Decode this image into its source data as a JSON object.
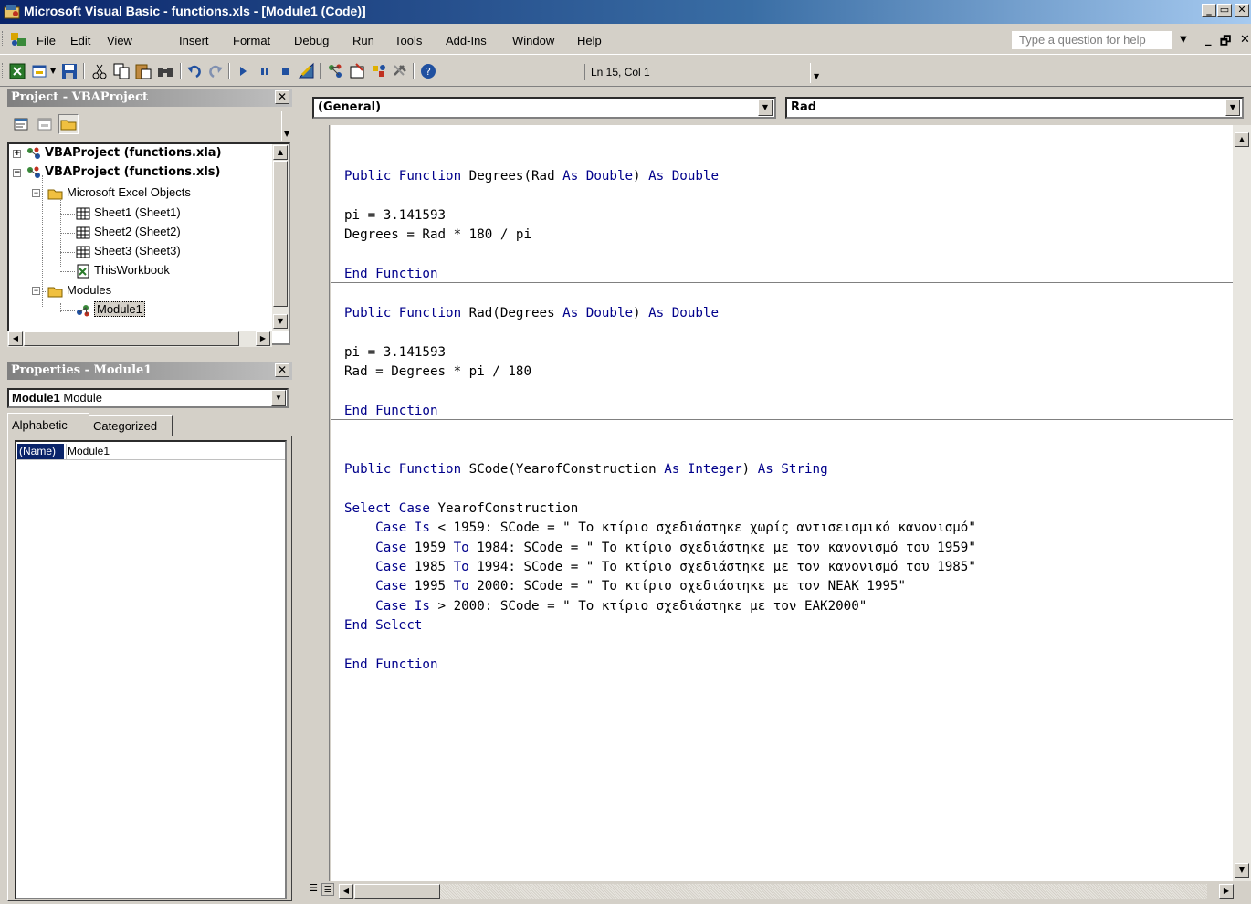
{
  "window": {
    "title": "Microsoft Visual Basic - functions.xls - [Module1 (Code)]",
    "minimize_glyph": "_",
    "restore_glyph": "🗗",
    "close_glyph": "✕"
  },
  "menubar": {
    "items": [
      "File",
      "Edit",
      "View",
      "Insert",
      "Format",
      "Debug",
      "Run",
      "Tools",
      "Add-Ins",
      "Window",
      "Help"
    ],
    "help_placeholder": "Type a question for help"
  },
  "toolbar": {
    "position_readout": "Ln 15, Col 1",
    "icons": [
      "view-excel-icon",
      "insert-userform-icon",
      "save-icon",
      "cut-icon",
      "copy-icon",
      "paste-icon",
      "find-icon",
      "undo-icon",
      "redo-icon",
      "run-icon",
      "break-icon",
      "reset-icon",
      "design-mode-icon",
      "project-explorer-icon",
      "properties-icon",
      "object-browser-icon",
      "toolbox-icon",
      "help-icon"
    ]
  },
  "project_panel": {
    "title": "Project - VBAProject",
    "tree": [
      {
        "label": "VBAProject (functions.xla)",
        "bold": true,
        "expander": "+"
      },
      {
        "label": "VBAProject (functions.xls)",
        "bold": true,
        "expander": "−"
      },
      {
        "label": "Microsoft Excel Objects",
        "expander": "−"
      },
      {
        "label": "Sheet1 (Sheet1)"
      },
      {
        "label": "Sheet2 (Sheet2)"
      },
      {
        "label": "Sheet3 (Sheet3)"
      },
      {
        "label": "ThisWorkbook"
      },
      {
        "label": "Modules",
        "expander": "−"
      },
      {
        "label": "Module1",
        "selected": true
      }
    ]
  },
  "properties_panel": {
    "title": "Properties - Module1",
    "object_name": "Module1",
    "object_type": "Module",
    "tabs": [
      "Alphabetic",
      "Categorized"
    ],
    "rows": [
      {
        "key": "(Name)",
        "value": "Module1"
      }
    ]
  },
  "code_window": {
    "object_combo": "(General)",
    "procedure_combo": "Rad",
    "lines": [
      {
        "row": 2,
        "parts": [
          {
            "k": true,
            "t": "Public Function "
          },
          {
            "k": false,
            "t": "Degrees(Rad "
          },
          {
            "k": true,
            "t": "As Double"
          },
          {
            "k": false,
            "t": ") "
          },
          {
            "k": true,
            "t": "As Double"
          }
        ]
      },
      {
        "row": 4,
        "parts": [
          {
            "k": false,
            "t": "pi = 3.141593"
          }
        ]
      },
      {
        "row": 5,
        "parts": [
          {
            "k": false,
            "t": "Degrees = Rad * 180 / pi"
          }
        ]
      },
      {
        "row": 7,
        "parts": [
          {
            "k": true,
            "t": "End Function"
          }
        ]
      },
      {
        "row": 9,
        "parts": [
          {
            "k": true,
            "t": "Public Function "
          },
          {
            "k": false,
            "t": "Rad(Degrees "
          },
          {
            "k": true,
            "t": "As Double"
          },
          {
            "k": false,
            "t": ") "
          },
          {
            "k": true,
            "t": "As Double"
          }
        ]
      },
      {
        "row": 11,
        "parts": [
          {
            "k": false,
            "t": "pi = 3.141593"
          }
        ]
      },
      {
        "row": 12,
        "parts": [
          {
            "k": false,
            "t": "Rad = Degrees * pi / 180"
          }
        ]
      },
      {
        "row": 14,
        "parts": [
          {
            "k": true,
            "t": "End Function"
          }
        ]
      },
      {
        "row": 17,
        "parts": [
          {
            "k": true,
            "t": "Public Function "
          },
          {
            "k": false,
            "t": "SCode(YearofConstruction "
          },
          {
            "k": true,
            "t": "As Integer"
          },
          {
            "k": false,
            "t": ") "
          },
          {
            "k": true,
            "t": "As String"
          }
        ]
      },
      {
        "row": 19,
        "parts": [
          {
            "k": true,
            "t": "Select Case "
          },
          {
            "k": false,
            "t": "YearofConstruction"
          }
        ]
      },
      {
        "row": 20,
        "parts": [
          {
            "k": false,
            "t": "    "
          },
          {
            "k": true,
            "t": "Case Is"
          },
          {
            "k": false,
            "t": " < 1959: SCode = \" Το κτίριο σχεδιάστηκε χωρίς αντισεισμικό κανονισμό\""
          }
        ]
      },
      {
        "row": 21,
        "parts": [
          {
            "k": false,
            "t": "    "
          },
          {
            "k": true,
            "t": "Case"
          },
          {
            "k": false,
            "t": " 1959 "
          },
          {
            "k": true,
            "t": "To"
          },
          {
            "k": false,
            "t": " 1984: SCode = \" Το κτίριο σχεδιάστηκε με τον κανονισμό του 1959\""
          }
        ]
      },
      {
        "row": 22,
        "parts": [
          {
            "k": false,
            "t": "    "
          },
          {
            "k": true,
            "t": "Case"
          },
          {
            "k": false,
            "t": " 1985 "
          },
          {
            "k": true,
            "t": "To"
          },
          {
            "k": false,
            "t": " 1994: SCode = \" Το κτίριο σχεδιάστηκε με τον κανονισμό του 1985\""
          }
        ]
      },
      {
        "row": 23,
        "parts": [
          {
            "k": false,
            "t": "    "
          },
          {
            "k": true,
            "t": "Case"
          },
          {
            "k": false,
            "t": " 1995 "
          },
          {
            "k": true,
            "t": "To"
          },
          {
            "k": false,
            "t": " 2000: SCode = \" Το κτίριο σχεδιάστηκε με τον ΝΕΑΚ 1995\""
          }
        ]
      },
      {
        "row": 24,
        "parts": [
          {
            "k": false,
            "t": "    "
          },
          {
            "k": true,
            "t": "Case Is"
          },
          {
            "k": false,
            "t": " > 2000: SCode = \" Το κτίριο σχεδιάστηκε με τον ΕΑΚ2000\""
          }
        ]
      },
      {
        "row": 25,
        "parts": [
          {
            "k": true,
            "t": "End Select"
          }
        ]
      },
      {
        "row": 27,
        "parts": [
          {
            "k": true,
            "t": "End Function"
          }
        ]
      }
    ],
    "separators_after_rows": [
      7,
      14
    ]
  }
}
